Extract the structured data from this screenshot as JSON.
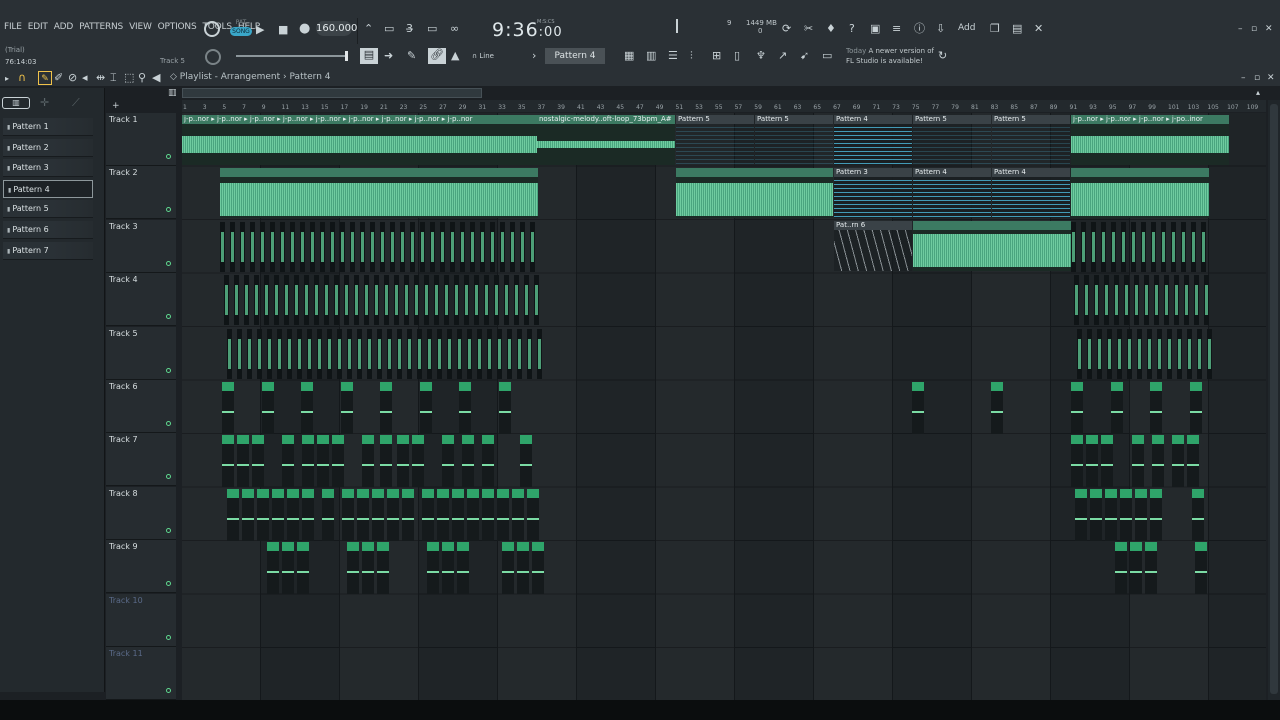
{
  "menu": [
    "FILE",
    "EDIT",
    "ADD",
    "PATTERNS",
    "VIEW",
    "OPTIONS",
    "TOOLS",
    "HELP"
  ],
  "status": {
    "trial": "(Trial)",
    "time": "76:14:03",
    "hint": "Track 5"
  },
  "transport": {
    "pat": "PAT",
    "song": "SONG",
    "tempo": "160.000",
    "clock_main": "9:36",
    "clock_sub": ":00",
    "clock_unit": "M:S:CS"
  },
  "perf": {
    "cpu": "9",
    "mem": "1449 MB",
    "mem_sub": "0"
  },
  "snap": {
    "label": "Line"
  },
  "pattern_selector": "Pattern 4",
  "add_label": "Add",
  "news": {
    "today": "Today",
    "line1": "A newer version of",
    "line2": "FL Studio is available!"
  },
  "playlist": {
    "title": "Playlist - Arrangement",
    "sep": "›",
    "current": "Pattern 4"
  },
  "patterns": [
    "Pattern 1",
    "Pattern 2",
    "Pattern 3",
    "Pattern 4",
    "Pattern 5",
    "Pattern 6",
    "Pattern 7"
  ],
  "selected_pattern": 3,
  "tracks": [
    "Track 1",
    "Track 2",
    "Track 3",
    "Track 4",
    "Track 5",
    "Track 6",
    "Track 7",
    "Track 8",
    "Track 9",
    "Track 10",
    "Track 11"
  ],
  "ruler": [
    "1",
    "3",
    "5",
    "7",
    "9",
    "11",
    "13",
    "15",
    "17",
    "19",
    "21",
    "23",
    "25",
    "27",
    "29",
    "31",
    "33",
    "35",
    "37",
    "39",
    "41",
    "43",
    "45",
    "47",
    "49",
    "51",
    "53",
    "55",
    "57",
    "59",
    "61",
    "63",
    "65",
    "67",
    "69",
    "71",
    "73",
    "75",
    "77",
    "79",
    "81",
    "83",
    "85",
    "87",
    "89",
    "91",
    "93",
    "95",
    "97",
    "99",
    "101",
    "103",
    "105",
    "107",
    "109"
  ],
  "clips": {
    "t1_a": "j-p..nor",
    "t1_melody": "nostalgic-melody..oft-loop_73bpm_A#",
    "p5": "Pattern 5",
    "p4": "Pattern 4",
    "p3": "Pattern 3",
    "p6": "Pat..rn 6",
    "t1_end": "j-po..inor"
  },
  "colors": {
    "audio": "#6fcca0",
    "pattern": "#46a7c6",
    "note": "#2fa46a",
    "accent": "#3aa7c9"
  }
}
